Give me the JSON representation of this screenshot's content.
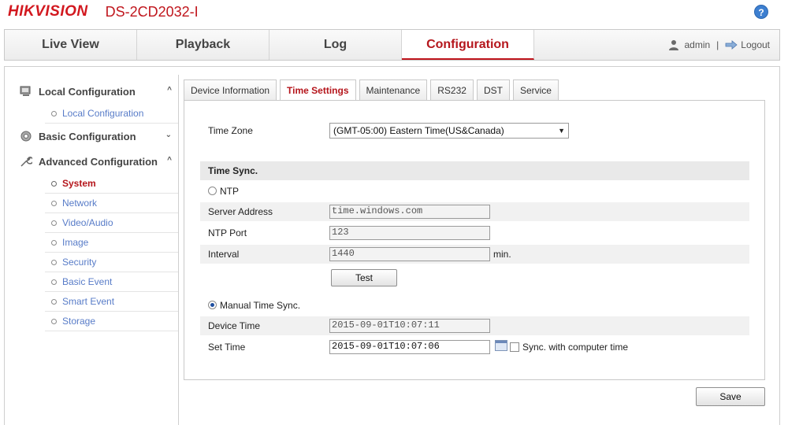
{
  "header": {
    "logo": "HIKVISION",
    "model": "DS-2CD2032-I",
    "help_label": "?"
  },
  "nav": {
    "items": [
      {
        "label": "Live View"
      },
      {
        "label": "Playback"
      },
      {
        "label": "Log"
      },
      {
        "label": "Configuration"
      }
    ],
    "user": "admin",
    "separator": "|",
    "logout": "Logout"
  },
  "sidebar": {
    "local": {
      "title": "Local Configuration",
      "items": [
        "Local Configuration"
      ]
    },
    "basic": {
      "title": "Basic Configuration"
    },
    "advanced": {
      "title": "Advanced Configuration",
      "items": [
        "System",
        "Network",
        "Video/Audio",
        "Image",
        "Security",
        "Basic Event",
        "Smart Event",
        "Storage"
      ]
    }
  },
  "tabs": [
    "Device Information",
    "Time Settings",
    "Maintenance",
    "RS232",
    "DST",
    "Service"
  ],
  "form": {
    "time_zone_label": "Time Zone",
    "time_zone_value": "(GMT-05:00) Eastern Time(US&Canada)",
    "time_sync_header": "Time Sync.",
    "ntp_label": "NTP",
    "server_address_label": "Server Address",
    "server_address_value": "time.windows.com",
    "ntp_port_label": "NTP Port",
    "ntp_port_value": "123",
    "interval_label": "Interval",
    "interval_value": "1440",
    "interval_unit": "min.",
    "test_button": "Test",
    "manual_label": "Manual Time Sync.",
    "device_time_label": "Device Time",
    "device_time_value": "2015-09-01T10:07:11",
    "set_time_label": "Set Time",
    "set_time_value": "2015-09-01T10:07:06",
    "sync_label": "Sync. with computer time"
  },
  "save_button": "Save",
  "colors": {
    "brand": "#d2181f",
    "active_tab": "#b5161c",
    "link": "#587cc8"
  }
}
